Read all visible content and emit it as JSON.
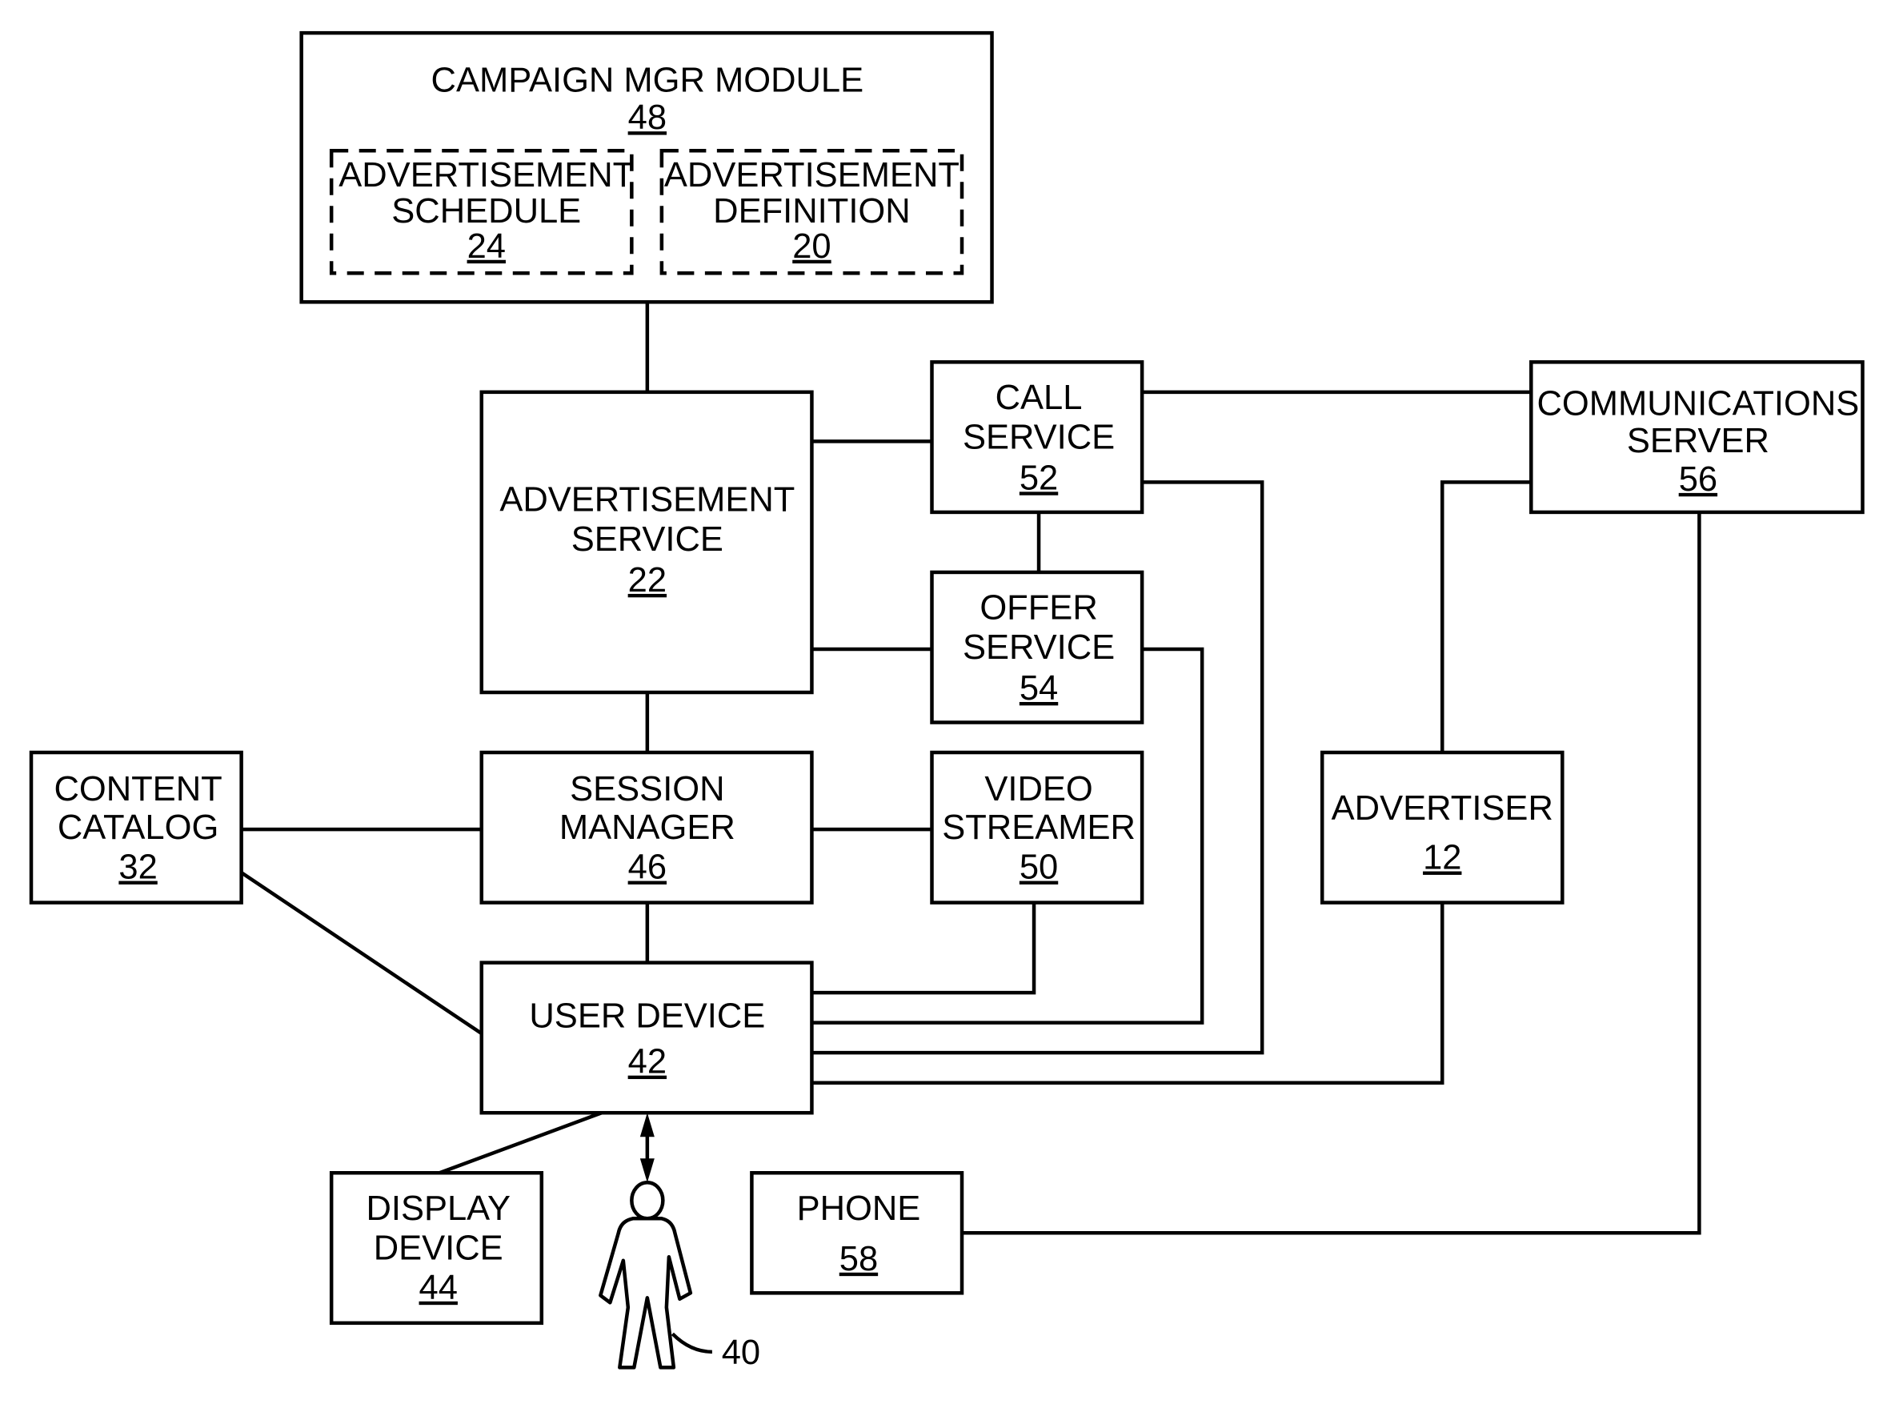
{
  "diagram": {
    "nodes": {
      "campaign_mgr": {
        "label": "CAMPAIGN MGR MODULE",
        "ref": "48"
      },
      "ad_schedule": {
        "line1": "ADVERTISEMENT",
        "line2": "SCHEDULE",
        "ref": "24"
      },
      "ad_definition": {
        "line1": "ADVERTISEMENT",
        "line2": "DEFINITION",
        "ref": "20"
      },
      "ad_service": {
        "line1": "ADVERTISEMENT",
        "line2": "SERVICE",
        "ref": "22"
      },
      "call_service": {
        "line1": "CALL",
        "line2": "SERVICE",
        "ref": "52"
      },
      "offer_service": {
        "line1": "OFFER",
        "line2": "SERVICE",
        "ref": "54"
      },
      "comm_server": {
        "line1": "COMMUNICATIONS",
        "line2": "SERVER",
        "ref": "56"
      },
      "content_catalog": {
        "line1": "CONTENT",
        "line2": "CATALOG",
        "ref": "32"
      },
      "session_manager": {
        "line1": "SESSION",
        "line2": "MANAGER",
        "ref": "46"
      },
      "video_streamer": {
        "line1": "VIDEO",
        "line2": "STREAMER",
        "ref": "50"
      },
      "advertiser": {
        "label": "ADVERTISER",
        "ref": "12"
      },
      "user_device": {
        "label": "USER DEVICE",
        "ref": "42"
      },
      "display_device": {
        "line1": "DISPLAY",
        "line2": "DEVICE",
        "ref": "44"
      },
      "phone": {
        "label": "PHONE",
        "ref": "58"
      },
      "user": {
        "ref": "40"
      }
    },
    "edges": [
      [
        "campaign_mgr",
        "ad_service"
      ],
      [
        "ad_service",
        "call_service"
      ],
      [
        "ad_service",
        "offer_service"
      ],
      [
        "ad_service",
        "session_manager"
      ],
      [
        "call_service",
        "offer_service"
      ],
      [
        "call_service",
        "comm_server"
      ],
      [
        "call_service",
        "user_device"
      ],
      [
        "offer_service",
        "user_device"
      ],
      [
        "comm_server",
        "advertiser"
      ],
      [
        "comm_server",
        "phone"
      ],
      [
        "content_catalog",
        "session_manager"
      ],
      [
        "content_catalog",
        "user_device"
      ],
      [
        "session_manager",
        "video_streamer"
      ],
      [
        "session_manager",
        "user_device"
      ],
      [
        "video_streamer",
        "user_device"
      ],
      [
        "advertiser",
        "user_device"
      ],
      [
        "user_device",
        "display_device"
      ],
      [
        "user_device",
        "user"
      ]
    ]
  }
}
